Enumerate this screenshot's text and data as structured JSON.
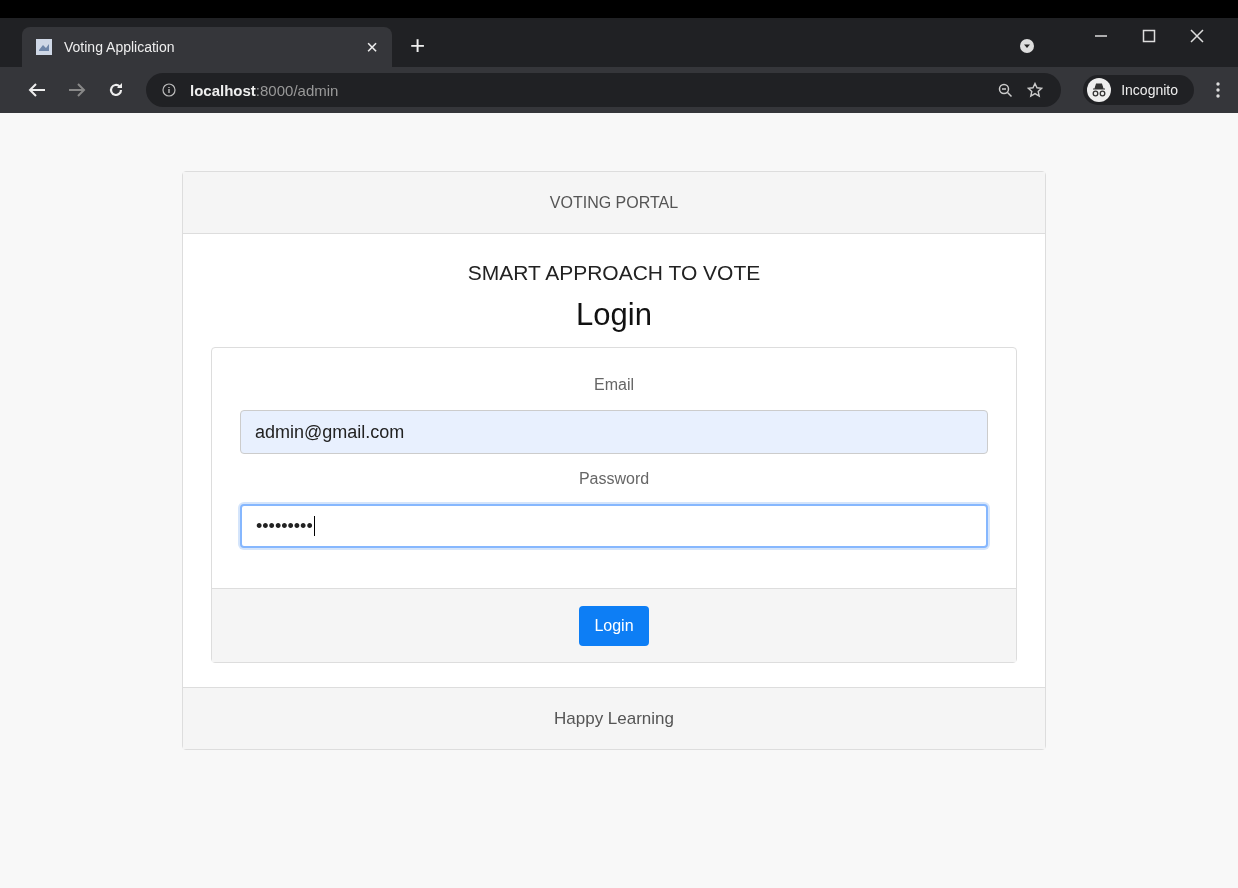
{
  "browser": {
    "tab": {
      "title": "Voting Application",
      "close": "×",
      "selected": true
    },
    "new_tab": "+",
    "address": {
      "host": "localhost",
      "rest": ":8000/admin"
    },
    "profile": "Incognito"
  },
  "card": {
    "header": "VOTING PORTAL",
    "subtitle": "SMART APPROACH TO VOTE",
    "title": "Login",
    "fields": [
      {
        "label": "Email",
        "value": "admin@gmail.com",
        "autofilled": true,
        "focused": false
      },
      {
        "label": "Password",
        "value": "•••••••••",
        "autofilled": false,
        "focused": true
      }
    ],
    "button": "Login",
    "footer": "Happy Learning"
  }
}
